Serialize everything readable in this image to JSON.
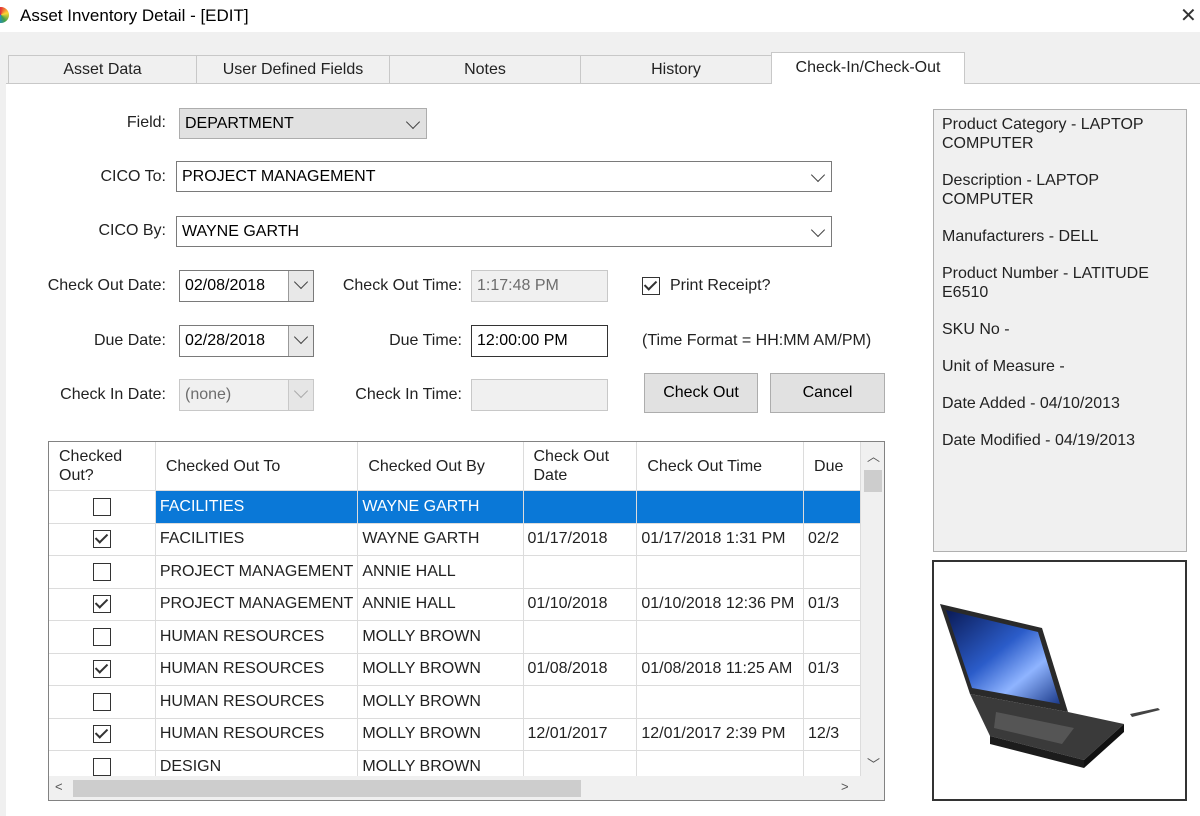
{
  "window": {
    "title": "Asset Inventory Detail - [EDIT]",
    "close_glyph": "✕"
  },
  "tabs": [
    "Asset Data",
    "User Defined Fields",
    "Notes",
    "History",
    "Check-In/Check-Out"
  ],
  "form": {
    "field_label": "Field:",
    "field_value": "DEPARTMENT",
    "cico_to_label": "CICO To:",
    "cico_to_value": "PROJECT MANAGEMENT",
    "cico_by_label": "CICO By:",
    "cico_by_value": "WAYNE GARTH",
    "check_out_date_label": "Check Out Date:",
    "check_out_date_value": "02/08/2018",
    "check_out_time_label": "Check Out Time:",
    "check_out_time_value": "1:17:48 PM",
    "print_receipt_label": "Print Receipt?",
    "print_receipt_checked": true,
    "due_date_label": "Due Date:",
    "due_date_value": "02/28/2018",
    "due_time_label": "Due Time:",
    "due_time_value": "12:00:00 PM",
    "time_format_note": "(Time Format = HH:MM AM/PM)",
    "check_in_date_label": "Check In Date:",
    "check_in_date_value": "(none)",
    "check_in_time_label": "Check In Time:",
    "check_in_time_value": "",
    "check_out_button": "Check Out",
    "cancel_button": "Cancel"
  },
  "grid": {
    "columns": [
      "Checked Out?",
      "Checked Out To",
      "Checked Out By",
      "Check Out Date",
      "Check Out Time",
      "Due"
    ],
    "rows": [
      {
        "checked": false,
        "to": "FACILITIES",
        "by": "WAYNE GARTH",
        "date": "",
        "time": "",
        "due": "",
        "selected": true
      },
      {
        "checked": true,
        "to": "FACILITIES",
        "by": "WAYNE GARTH",
        "date": "01/17/2018",
        "time": "01/17/2018 1:31 PM",
        "due": "02/2"
      },
      {
        "checked": false,
        "to": "PROJECT MANAGEMENT",
        "by": "ANNIE HALL",
        "date": "",
        "time": "",
        "due": ""
      },
      {
        "checked": true,
        "to": "PROJECT MANAGEMENT",
        "by": "ANNIE HALL",
        "date": "01/10/2018",
        "time": "01/10/2018 12:36 PM",
        "due": "01/3"
      },
      {
        "checked": false,
        "to": "HUMAN RESOURCES",
        "by": "MOLLY BROWN",
        "date": "",
        "time": "",
        "due": ""
      },
      {
        "checked": true,
        "to": "HUMAN RESOURCES",
        "by": "MOLLY BROWN",
        "date": "01/08/2018",
        "time": "01/08/2018 11:25 AM",
        "due": "01/3"
      },
      {
        "checked": false,
        "to": "HUMAN RESOURCES",
        "by": "MOLLY BROWN",
        "date": "",
        "time": "",
        "due": ""
      },
      {
        "checked": true,
        "to": "HUMAN RESOURCES",
        "by": "MOLLY BROWN",
        "date": "12/01/2017",
        "time": "12/01/2017 2:39 PM",
        "due": "12/3"
      },
      {
        "checked": false,
        "to": "DESIGN",
        "by": "MOLLY BROWN",
        "date": "",
        "time": "",
        "due": ""
      }
    ]
  },
  "info": [
    "Product Category - LAPTOP COMPUTER",
    "Description - LAPTOP COMPUTER",
    "Manufacturers - DELL",
    "Product Number - LATITUDE E6510",
    "SKU No -",
    "Unit of Measure -",
    "Date Added - 04/10/2013",
    "Date Modified - 04/19/2013"
  ],
  "colors": {
    "selection": "#0a78d7",
    "panel": "#f0f0f0",
    "button": "#e1e1e1"
  },
  "icons": [
    "app-logo-icon",
    "close-icon",
    "dropdown-chevron-icon",
    "calendar-dropdown-icon",
    "scroll-up-icon",
    "scroll-down-icon",
    "scroll-left-icon",
    "scroll-right-icon",
    "laptop-product-image"
  ]
}
